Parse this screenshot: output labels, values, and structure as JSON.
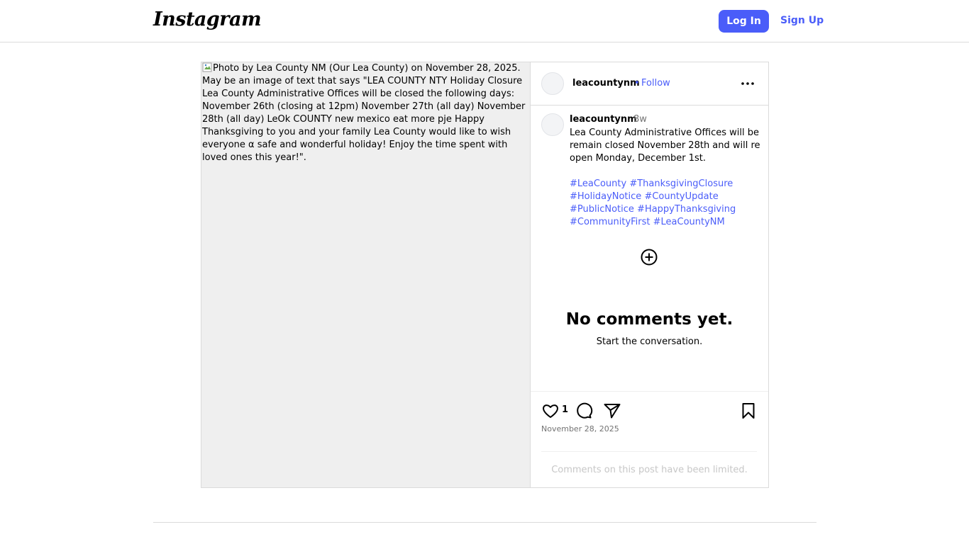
{
  "header": {
    "logo": "Instagram",
    "login_label": "Log In",
    "signup_label": "Sign Up"
  },
  "post": {
    "image_alt": "Photo by Lea County NM (Our Lea County) on November 28, 2025. May be an image of text that says \"LEA COUNTY NTY Holiday Closure Lea County Administrative Offices will be closed the following days: November 26th (closing at 12pm) November 27th (all day) November 28th (all day) LeOk COUNTY new mexico eat more pje Happy Thanksgiving to you and your family Lea County would like to wish everyone α safe and wonderful holiday! Enjoy the time spent with loved ones this year!\".",
    "username": "leacountynm",
    "separator": "•",
    "follow_label": "Follow",
    "caption": {
      "username": "leacountynm",
      "time_ago": "8w",
      "text": "Lea County Administrative Offices will be remain closed November 28th and will re open Monday, December 1st.",
      "hashtags": [
        "#LeaCounty",
        "#ThanksgivingClosure",
        "#HolidayNotice",
        "#CountyUpdate",
        "#PublicNotice",
        "#HappyThanksgiving",
        "#CommunityFirst",
        "#LeaCountyNM"
      ]
    },
    "no_comments_title": "No comments yet.",
    "no_comments_sub": "Start the conversation.",
    "like_count": "1",
    "date": "November 28, 2025",
    "comments_limited": "Comments on this post have been limited."
  },
  "icons": {
    "more": "more-horizontal-icon",
    "load_more": "plus-circle-icon",
    "like": "heart-icon",
    "comment": "comment-icon",
    "share": "share-icon",
    "save": "bookmark-icon"
  },
  "colors": {
    "accent": "#4a5df9",
    "border": "#dbdbdb",
    "muted": "#737373",
    "photo_bg": "#efefef"
  }
}
